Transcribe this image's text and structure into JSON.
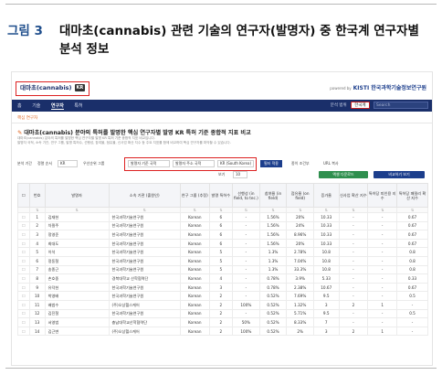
{
  "caption": {
    "label": "그림 3",
    "title": "대마초(cannabis) 관련 기술의 연구자(발명자) 중 한국계 연구자별 분석 정보"
  },
  "app": {
    "title": "대마초(cannabis)",
    "tag": "KR",
    "powered": "powered by",
    "brand_small": "KISTI",
    "brand": "KISTI 한국과학기술정보연구원"
  },
  "nav": {
    "items": [
      "홈",
      "기술",
      "연구자",
      "특허"
    ],
    "active_index": 2,
    "scope_label": "분석 범위",
    "scope_value": "한국계",
    "search_placeholder": "Search"
  },
  "breadcrumb": "핵심 연구자",
  "section": {
    "title": "대마초(cannabis) 분야의 특허를 발명한 핵심 연구자별 발명 KR 특허 기준 종합적 지표 비교",
    "description_line1": "대마초(cannabis) 분야의 특허를 발명한 핵심 연구자별 발명 KR 특허 기준 종합적 지표 비교입니다.",
    "description_line2": "발명자 국적, 소속 기관, 연구 그룹, 발명 특허수, 선행성, 참여율, 점유율, 신사업 확산 지수 등 주요 지표를 함께 비교하여 핵심 연구자를 파악할 수 있습니다."
  },
  "filters": {
    "period_label": "분석 기간",
    "sort_label": "정렬 순서",
    "sort_value": "KR",
    "type_label": "우선순위 그룹",
    "f1": "발명자 기준 국적",
    "f2": "발명자 주소 국적",
    "f3": "KR (South Korea)",
    "apply": "필터 적용",
    "opt1": "종이 조건부",
    "opt2": "URL 복사"
  },
  "tools": {
    "rows_label": "보기",
    "rows_value": "10",
    "excel": "엑셀 다운로드",
    "compare": "비교하기 보기"
  },
  "table": {
    "headers": [
      "번호",
      "발명자",
      "소속 기관 (출원인)",
      "연구 그룹 (추정)",
      "발명 특허수",
      "선행성 (in field, to tec.)",
      "참여율 (in field)",
      "점유율 (on field)",
      "증가율",
      "신사업 확산 지수",
      "특허당 피인용 지수",
      "특허당 패밀리 확산 지수"
    ],
    "rows": [
      [
        "1",
        "김재헌",
        "한국과학기술연구원",
        "Korean",
        "6",
        "-",
        "1.56%",
        "20%",
        "10.33",
        "-",
        "-",
        "0.67"
      ],
      [
        "2",
        "차필주",
        "한국과학기술연구원",
        "Korean",
        "6",
        "-",
        "1.56%",
        "24%",
        "10.33",
        "-",
        "-",
        "0.67"
      ],
      [
        "3",
        "정영준",
        "한국과학기술연구원",
        "Korean",
        "6",
        "-",
        "1.56%",
        "8.96%",
        "10.33",
        "-",
        "-",
        "0.67"
      ],
      [
        "4",
        "최대도",
        "한국과학기술연구원",
        "Korean",
        "6",
        "-",
        "1.56%",
        "20%",
        "10.33",
        "-",
        "-",
        "0.67"
      ],
      [
        "5",
        "이석",
        "한국과학기술연구원",
        "Korean",
        "5",
        "-",
        "1.3%",
        "2.78%",
        "10.8",
        "-",
        "-",
        "0.8"
      ],
      [
        "6",
        "정동철",
        "한국과학기술연구원",
        "Korean",
        "5",
        "-",
        "1.3%",
        "7.04%",
        "10.8",
        "-",
        "-",
        "0.8"
      ],
      [
        "7",
        "송종근",
        "한국과학기술연구원",
        "Korean",
        "5",
        "-",
        "1.3%",
        "33.3%",
        "10.8",
        "-",
        "-",
        "0.8"
      ],
      [
        "8",
        "손호중",
        "경북대학교 산학협력단",
        "Korean",
        "4",
        "-",
        "0.78%",
        "3.9%",
        "5.33",
        "-",
        "-",
        "0.33"
      ],
      [
        "9",
        "유덕헌",
        "한국과학기술연구원",
        "Korean",
        "3",
        "-",
        "0.78%",
        "2.38%",
        "10.67",
        "-",
        "-",
        "0.67"
      ],
      [
        "10",
        "박영배",
        "한국과학기술연구원",
        "Korean",
        "2",
        "-",
        "0.52%",
        "7.69%",
        "9.5",
        "-",
        "-",
        "0.5"
      ],
      [
        "11",
        "배범수",
        "(주)오상헬스케어",
        "Korean",
        "2",
        "100%",
        "0.52%",
        "1.32%",
        "3",
        "2",
        "1",
        "-"
      ],
      [
        "12",
        "김진철",
        "한국과학기술연구원",
        "Korean",
        "2",
        "-",
        "0.52%",
        "5.71%",
        "9.5",
        "-",
        "-",
        "0.5"
      ],
      [
        "13",
        "서영범",
        "충남대학교산학협력단",
        "Korean",
        "2",
        "50%",
        "0.52%",
        "8.33%",
        "7",
        "-",
        "-",
        "-"
      ],
      [
        "14",
        "김근변",
        "(주)오상헬스케어",
        "Korean",
        "2",
        "100%",
        "0.52%",
        "2%",
        "3",
        "2",
        "1",
        "-"
      ]
    ]
  }
}
